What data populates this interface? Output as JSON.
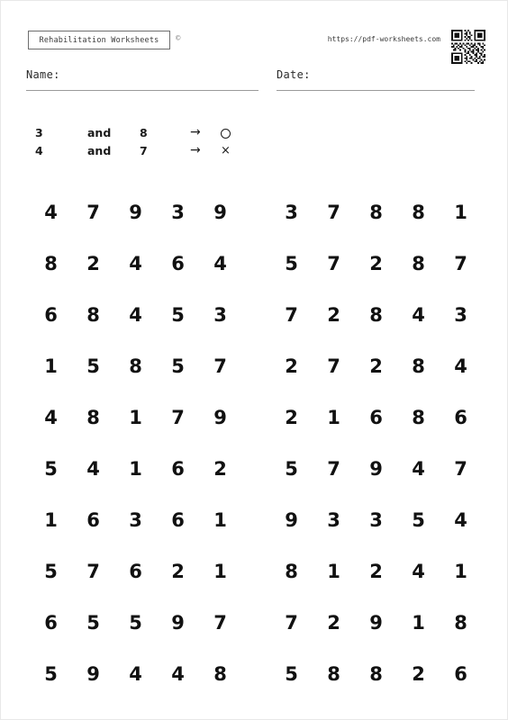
{
  "header": {
    "logo_text": "Rehabilitation Worksheets",
    "copyright_symbol": "©",
    "site_url": "https://pdf-worksheets.com",
    "qr_code_icon": "qr-code-icon"
  },
  "fields": {
    "name_label": "Name:",
    "name_value": "",
    "date_label": "Date:",
    "date_value": ""
  },
  "legend": {
    "rows": [
      {
        "first_number": "3",
        "conjunction": "and",
        "second_number": "8",
        "arrow": "→",
        "symbol": "○",
        "symbol_name": "circle-symbol"
      },
      {
        "first_number": "4",
        "conjunction": "and",
        "second_number": "7",
        "arrow": "→",
        "symbol": "×",
        "symbol_name": "cross-symbol"
      }
    ]
  },
  "grid": {
    "rows": [
      {
        "left": [
          "4",
          "7",
          "9",
          "3",
          "9"
        ],
        "right": [
          "3",
          "7",
          "8",
          "8",
          "1"
        ]
      },
      {
        "left": [
          "8",
          "2",
          "4",
          "6",
          "4"
        ],
        "right": [
          "5",
          "7",
          "2",
          "8",
          "7"
        ]
      },
      {
        "left": [
          "6",
          "8",
          "4",
          "5",
          "3"
        ],
        "right": [
          "7",
          "2",
          "8",
          "4",
          "3"
        ]
      },
      {
        "left": [
          "1",
          "5",
          "8",
          "5",
          "7"
        ],
        "right": [
          "2",
          "7",
          "2",
          "8",
          "4"
        ]
      },
      {
        "left": [
          "4",
          "8",
          "1",
          "7",
          "9"
        ],
        "right": [
          "2",
          "1",
          "6",
          "8",
          "6"
        ]
      },
      {
        "left": [
          "5",
          "4",
          "1",
          "6",
          "2"
        ],
        "right": [
          "5",
          "7",
          "9",
          "4",
          "7"
        ]
      },
      {
        "left": [
          "1",
          "6",
          "3",
          "6",
          "1"
        ],
        "right": [
          "9",
          "3",
          "3",
          "5",
          "4"
        ]
      },
      {
        "left": [
          "5",
          "7",
          "6",
          "2",
          "1"
        ],
        "right": [
          "8",
          "1",
          "2",
          "4",
          "1"
        ]
      },
      {
        "left": [
          "6",
          "5",
          "5",
          "9",
          "7"
        ],
        "right": [
          "7",
          "2",
          "9",
          "1",
          "8"
        ]
      },
      {
        "left": [
          "5",
          "9",
          "4",
          "4",
          "8"
        ],
        "right": [
          "5",
          "8",
          "8",
          "2",
          "6"
        ]
      }
    ]
  },
  "colors": {
    "text": "#111111",
    "rule": "#9a9a9a",
    "box_border": "#6e6e6e",
    "page_border": "#e8e8e8"
  }
}
